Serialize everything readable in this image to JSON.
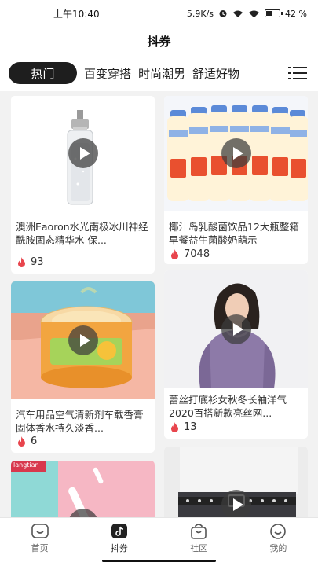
{
  "status_bar": {
    "time": "上午10:40",
    "speed": "5.9K/s",
    "battery_text": "42 %",
    "battery_level": 0.42
  },
  "header": {
    "title": "抖券"
  },
  "tabs": [
    {
      "label": "热门",
      "active": true
    },
    {
      "label": "百变穿搭",
      "active": false
    },
    {
      "label": "时尚潮男",
      "active": false
    },
    {
      "label": "舒适好物",
      "active": false
    }
  ],
  "products": [
    {
      "title": "澳洲Eaoron水光南极冰川神经酰胺固态精华水 保...",
      "likes": "93"
    },
    {
      "title": "椰汁岛乳酸菌饮品12大瓶整箱早餐益生菌酸奶萌示",
      "likes": "7048"
    },
    {
      "title": "汽车用品空气清新剂车载香膏固体香水持久淡香...",
      "likes": "6"
    },
    {
      "title": "蕾丝打底衫女秋冬长袖洋气2020百搭新款亮丝网...",
      "likes": "13"
    },
    {
      "brand": "langtian"
    }
  ],
  "bottom_nav": [
    {
      "label": "首页",
      "icon": "home-icon",
      "active": false
    },
    {
      "label": "抖券",
      "icon": "tiktok-icon",
      "active": true
    },
    {
      "label": "社区",
      "icon": "bag-icon",
      "active": false
    },
    {
      "label": "我的",
      "icon": "smile-icon",
      "active": false
    }
  ],
  "colors": {
    "accent": "#e8454d",
    "active_tab_bg": "#1e1e1e"
  }
}
